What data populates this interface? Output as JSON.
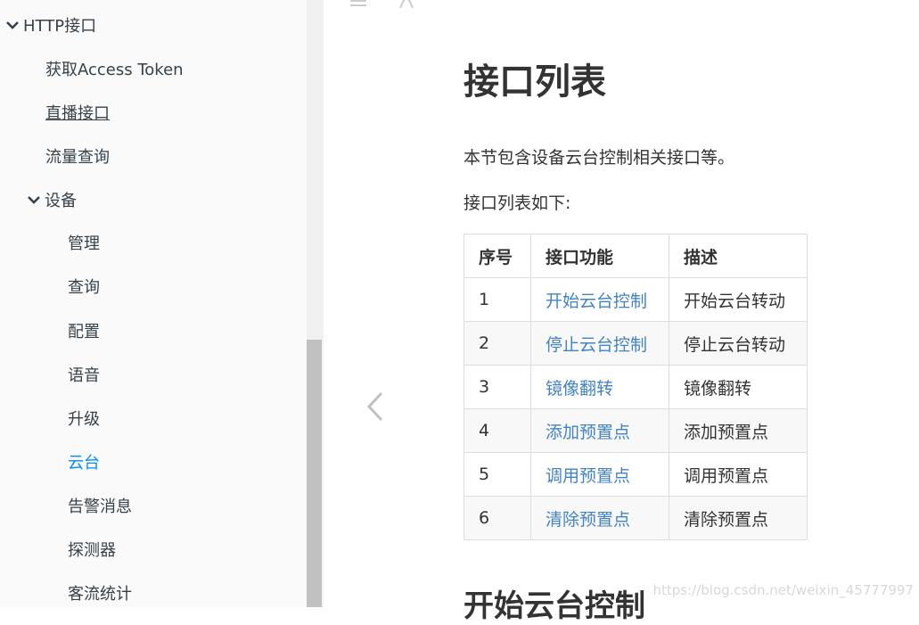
{
  "sidebar": {
    "items": [
      {
        "label": "HTTP接口",
        "level": 0,
        "expanded": true
      },
      {
        "label": "获取Access Token",
        "level": 1
      },
      {
        "label": "直播接口",
        "level": 1,
        "underline": true
      },
      {
        "label": "流量查询",
        "level": 1
      },
      {
        "label": "设备",
        "level": 1,
        "expanded": true
      },
      {
        "label": "管理",
        "level": 2
      },
      {
        "label": "查询",
        "level": 2
      },
      {
        "label": "配置",
        "level": 2
      },
      {
        "label": "语音",
        "level": 2
      },
      {
        "label": "升级",
        "level": 2
      },
      {
        "label": "云台",
        "level": 2,
        "active": true
      },
      {
        "label": "告警消息",
        "level": 2
      },
      {
        "label": "探测器",
        "level": 2
      },
      {
        "label": "客流统计",
        "level": 2
      }
    ]
  },
  "toolbar": {
    "menu_icon": "hamburger-icon",
    "font_icon": "font-size-icon"
  },
  "main": {
    "title": "接口列表",
    "intro": "本节包含设备云台控制相关接口等。",
    "list_intro": "接口列表如下:",
    "table": {
      "headers": [
        "序号",
        "接口功能",
        "描述"
      ],
      "rows": [
        [
          "1",
          "开始云台控制",
          "开始云台转动"
        ],
        [
          "2",
          "停止云台控制",
          "停止云台转动"
        ],
        [
          "3",
          "镜像翻转",
          "镜像翻转"
        ],
        [
          "4",
          "添加预置点",
          "添加预置点"
        ],
        [
          "5",
          "调用预置点",
          "调用预置点"
        ],
        [
          "6",
          "清除预置点",
          "清除预置点"
        ]
      ]
    },
    "next_heading": "开始云台控制"
  },
  "watermark": "https://blog.csdn.net/weixin_45777997",
  "colors": {
    "link": "#4183c4",
    "active": "#008cff",
    "sidebar_bg": "#fafafa"
  }
}
